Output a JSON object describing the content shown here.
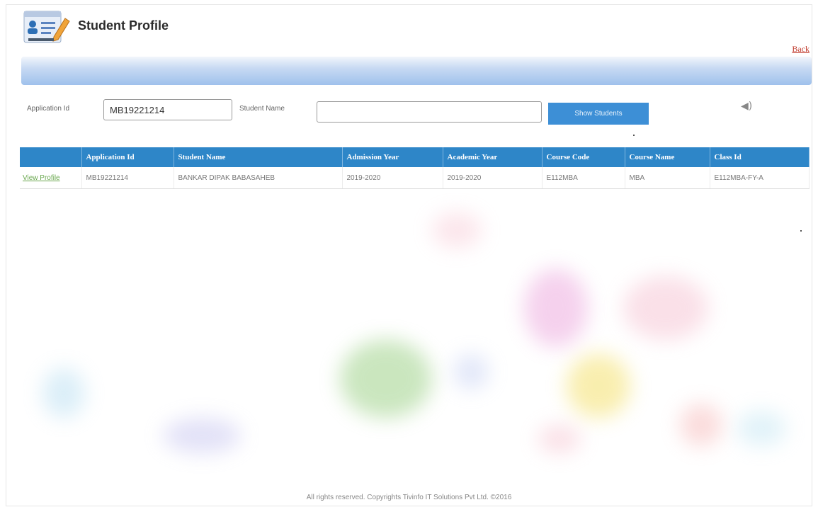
{
  "header": {
    "title": "Student Profile",
    "logo_icon": "profile-edit-icon",
    "back_label": "Back"
  },
  "search": {
    "application_id_label": "Application Id",
    "application_id_value": "MB19221214",
    "student_name_label": "Student Name",
    "student_name_value": "",
    "show_button_label": "Show Students"
  },
  "table": {
    "columns": [
      "",
      "Application Id",
      "Student Name",
      "Admission Year",
      "Academic Year",
      "Course Code",
      "Course Name",
      "Class Id"
    ],
    "rows": [
      {
        "action": "View Profile",
        "application_id": "MB19221214",
        "student_name": "BANKAR DIPAK BABASAHEB",
        "admission_year": "2019-2020",
        "academic_year": "2019-2020",
        "course_code": "E112MBA",
        "course_name": "MBA",
        "class_id": "E112MBA-FY-A"
      }
    ]
  },
  "footer": {
    "text": "All rights reserved. Copyrights Tivinfo IT Solutions Pvt Ltd. ©2016"
  },
  "colors": {
    "header_blue": "#2e86c8",
    "button_blue": "#3d8fd6",
    "link_green": "#6aa84f",
    "back_red": "#c0392b"
  }
}
